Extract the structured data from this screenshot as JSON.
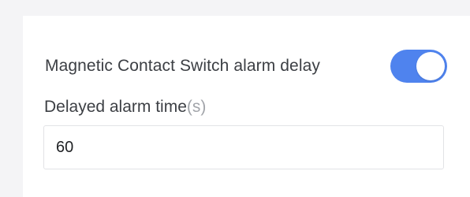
{
  "settings": {
    "alarm_delay": {
      "label": "Magnetic Contact Switch alarm delay",
      "enabled": true,
      "toggle_color": "#4f83ee"
    },
    "delayed_time": {
      "label": "Delayed alarm time",
      "unit": "(s)",
      "value": "60"
    }
  }
}
